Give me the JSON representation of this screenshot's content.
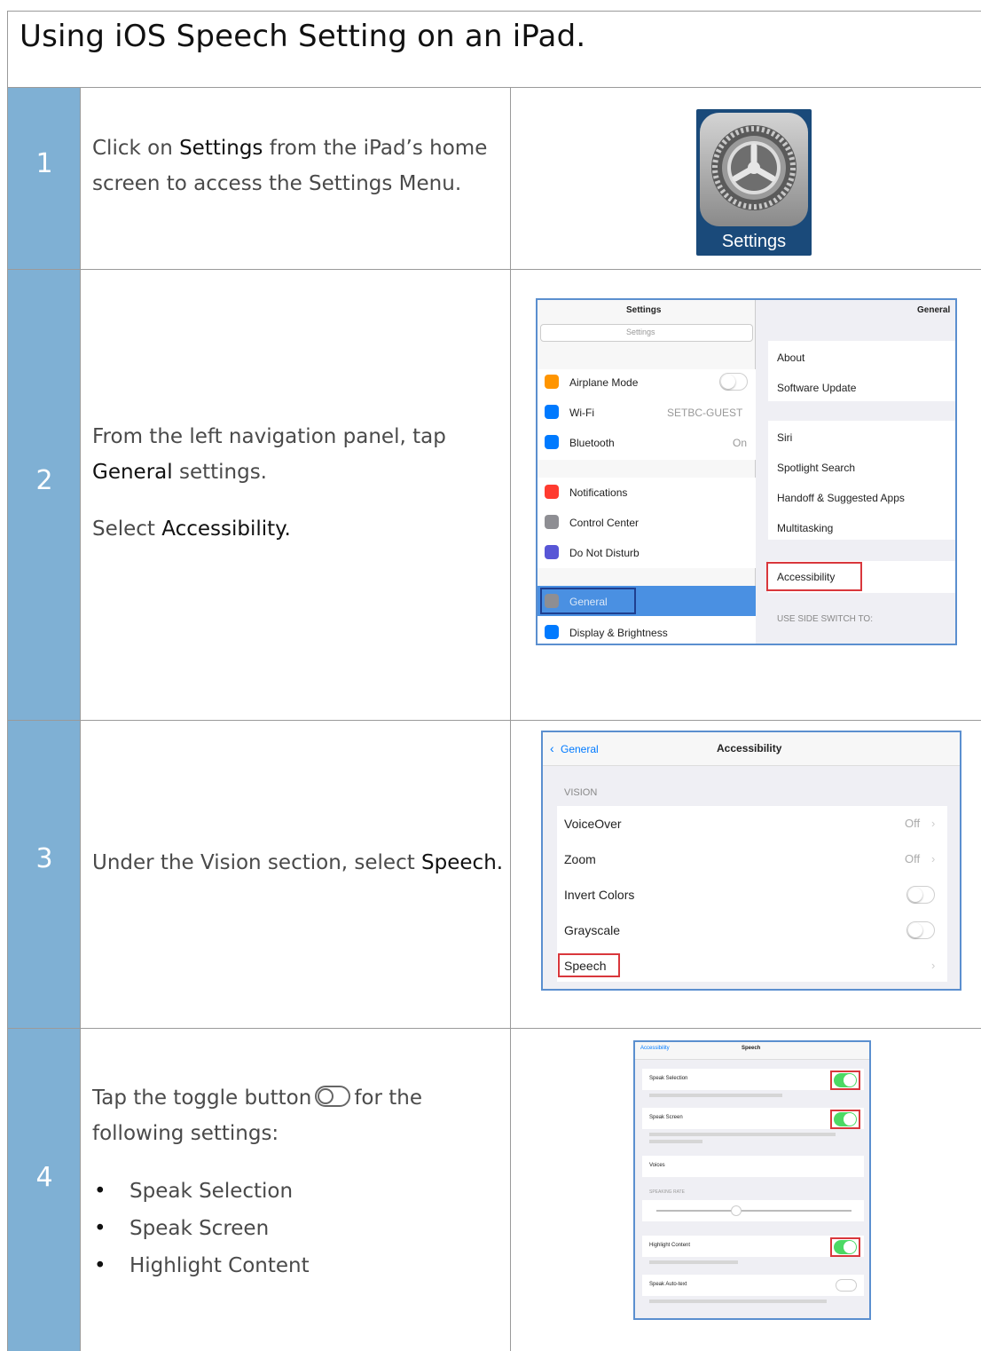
{
  "title": "Using iOS Speech Setting on an iPad.",
  "steps": [
    {
      "number": "1",
      "text_a": "Click on ",
      "text_b": "Settings",
      "text_c": " from the iPad’s home",
      "text_d": "screen to access the Settings Menu.",
      "icon_label": "Settings"
    },
    {
      "number": "2",
      "line1": "From the left navigation panel, tap",
      "line2_bold": "General",
      "line2_rest": " settings.",
      "line3_a": "Select ",
      "line3_bold": "Accessibility."
    },
    {
      "number": "3",
      "text_a": "Under the Vision section, select ",
      "text_bold": "Speech."
    },
    {
      "number": "4",
      "line1_a": "Tap the toggle button",
      "line1_b": "for the",
      "line2": "following settings:",
      "bullets": [
        "Speak Selection",
        "Speak Screen",
        "Highlight Content"
      ]
    }
  ],
  "shot2": {
    "left_title": "Settings",
    "right_title": "General",
    "search_placeholder": "Settings",
    "left_items": [
      {
        "label": "Airplane Mode",
        "value": "",
        "icon_color": "#ff9500"
      },
      {
        "label": "Wi-Fi",
        "value": "SETBC-GUEST",
        "icon_color": "#007aff"
      },
      {
        "label": "Bluetooth",
        "value": "On",
        "icon_color": "#007aff"
      },
      {
        "label": "Notifications",
        "value": "",
        "icon_color": "#ff3b30"
      },
      {
        "label": "Control Center",
        "value": "",
        "icon_color": "#8e8e93"
      },
      {
        "label": "Do Not Disturb",
        "value": "",
        "icon_color": "#5856d6"
      },
      {
        "label": "General",
        "value": "",
        "icon_color": "#8e8e93"
      },
      {
        "label": "Display & Brightness",
        "value": "",
        "icon_color": "#007aff"
      }
    ],
    "right_items": [
      "About",
      "Software Update",
      "Siri",
      "Spotlight Search",
      "Handoff & Suggested Apps",
      "Multitasking",
      "Accessibility"
    ],
    "right_section": "USE SIDE SWITCH TO:"
  },
  "shot3": {
    "back": "General",
    "title": "Accessibility",
    "section": "VISION",
    "items": [
      {
        "label": "VoiceOver",
        "value": "Off"
      },
      {
        "label": "Zoom",
        "value": "Off"
      },
      {
        "label": "Invert Colors",
        "value": ""
      },
      {
        "label": "Grayscale",
        "value": ""
      },
      {
        "label": "Speech",
        "value": ""
      }
    ]
  },
  "shot4": {
    "back": "Accessibility",
    "title": "Speech",
    "items": [
      "Speak Selection",
      "Speak Screen",
      "Voices",
      "Highlight Content",
      "Speak Auto-text"
    ],
    "section": "SPEAKING RATE"
  }
}
